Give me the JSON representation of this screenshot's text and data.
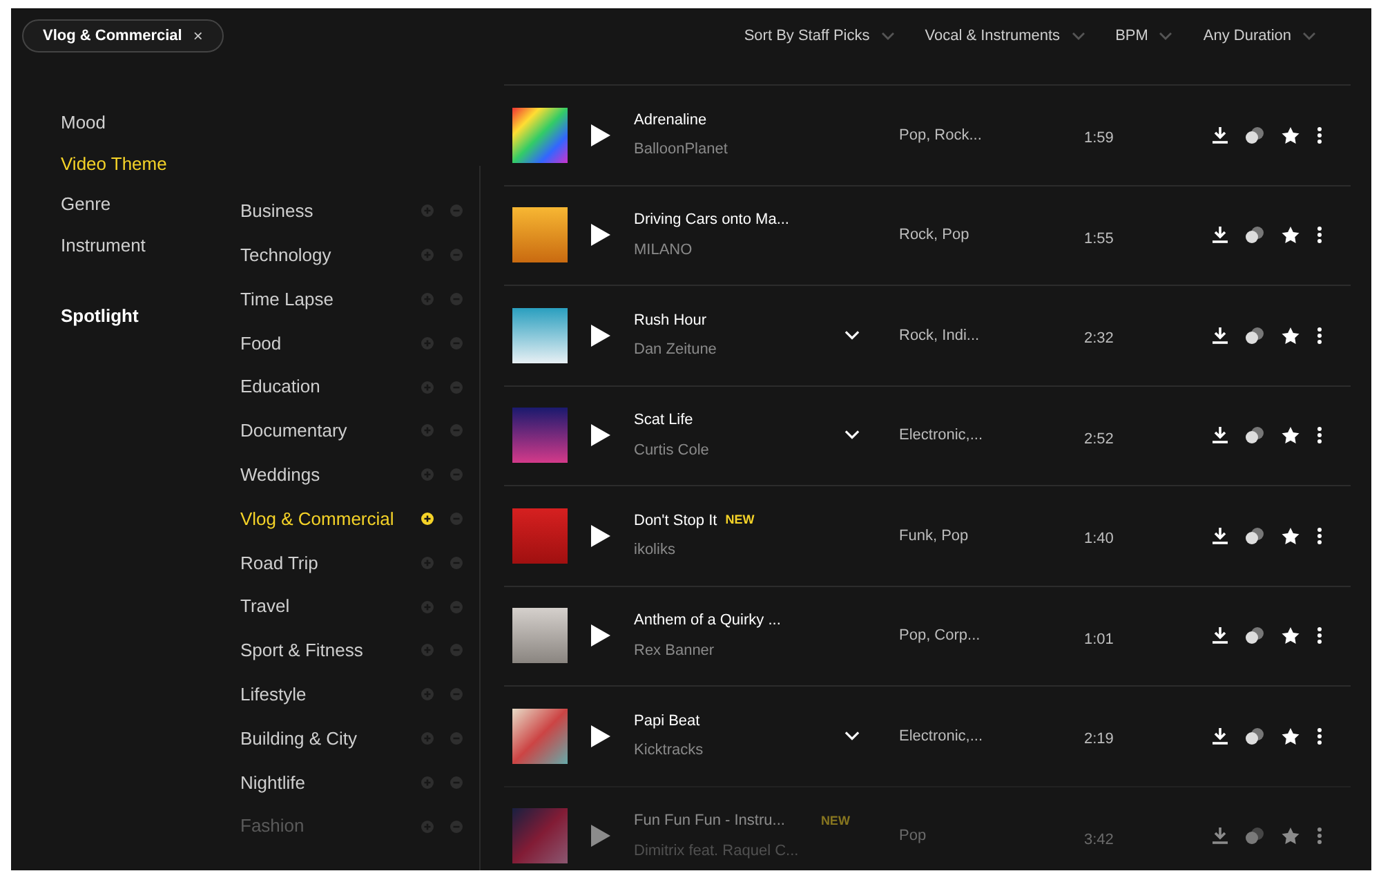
{
  "filter_chip": {
    "label": "Vlog & Commercial",
    "close": "×"
  },
  "dropdowns": [
    {
      "label": "Sort By Staff Picks"
    },
    {
      "label": "Vocal & Instruments"
    },
    {
      "label": "BPM"
    },
    {
      "label": "Any Duration"
    }
  ],
  "nav": [
    {
      "label": "Mood",
      "selected": false,
      "kind": "category"
    },
    {
      "label": "Video Theme",
      "selected": true,
      "kind": "category"
    },
    {
      "label": "Genre",
      "selected": false,
      "kind": "category"
    },
    {
      "label": "Instrument",
      "selected": false,
      "kind": "category"
    },
    {
      "label": "Spotlight",
      "selected": false,
      "kind": "special"
    }
  ],
  "themes": [
    {
      "label": "Business",
      "included": false,
      "faded": false
    },
    {
      "label": "Technology",
      "included": false,
      "faded": false
    },
    {
      "label": "Time Lapse",
      "included": false,
      "faded": false
    },
    {
      "label": "Food",
      "included": false,
      "faded": false
    },
    {
      "label": "Education",
      "included": false,
      "faded": false
    },
    {
      "label": "Documentary",
      "included": false,
      "faded": false
    },
    {
      "label": "Weddings",
      "included": false,
      "faded": false
    },
    {
      "label": "Vlog & Commercial",
      "included": true,
      "faded": false
    },
    {
      "label": "Road Trip",
      "included": false,
      "faded": false
    },
    {
      "label": "Travel",
      "included": false,
      "faded": false
    },
    {
      "label": "Sport & Fitness",
      "included": false,
      "faded": false
    },
    {
      "label": "Lifestyle",
      "included": false,
      "faded": false
    },
    {
      "label": "Building & City",
      "included": false,
      "faded": false
    },
    {
      "label": "Nightlife",
      "included": false,
      "faded": false
    },
    {
      "label": "Fashion",
      "included": false,
      "faded": true
    }
  ],
  "tracks": [
    {
      "title": "Adrenaline",
      "artist": "BalloonPlanet",
      "genres": "Pop,  Rock...",
      "duration": "1:59",
      "expandable": false,
      "faded": false
    },
    {
      "title": "Driving Cars onto Ma...",
      "artist": "MILANO",
      "genres": "Rock,  Pop",
      "duration": "1:55",
      "expandable": false,
      "faded": false
    },
    {
      "title": "Rush Hour",
      "artist": "Dan Zeitune",
      "genres": "Rock,  Indi...",
      "duration": "2:32",
      "expandable": true,
      "faded": false
    },
    {
      "title": "Scat Life",
      "artist": "Curtis Cole",
      "genres": "Electronic,...",
      "duration": "2:52",
      "expandable": true,
      "faded": false
    },
    {
      "title": "Don't Stop It",
      "badge": "NEW",
      "artist": "ikoliks",
      "genres": "Funk,  Pop",
      "duration": "1:40",
      "expandable": false,
      "faded": false
    },
    {
      "title": "Anthem of a Quirky ...",
      "artist": "Rex Banner",
      "genres": "Pop,  Corp...",
      "duration": "1:01",
      "expandable": false,
      "faded": false
    },
    {
      "title": "Papi Beat",
      "artist": "Kicktracks",
      "genres": "Electronic,...",
      "duration": "2:19",
      "expandable": true,
      "faded": false
    },
    {
      "title": "Fun Fun Fun - Instru...",
      "badge": "NEW",
      "artist": "Dimitrix feat. Raquel C...",
      "genres": "Pop",
      "duration": "3:42",
      "expandable": false,
      "faded": true
    }
  ]
}
